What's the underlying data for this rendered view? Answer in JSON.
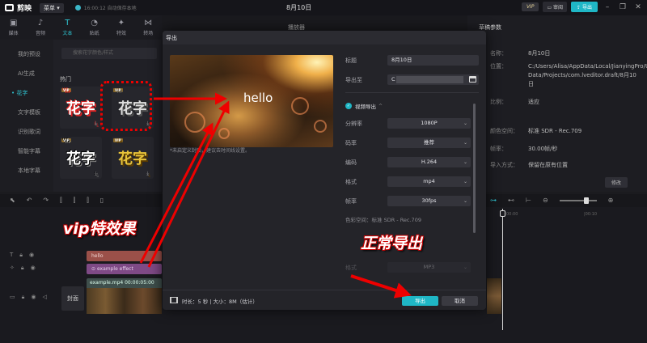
{
  "app": {
    "name": "剪映",
    "menu_label": "菜单",
    "autosave": "16:00:12 自动保存本地",
    "window_title": "8月10日",
    "vip": "VIP",
    "review": "审阅",
    "export": "导出"
  },
  "tools": [
    {
      "label": "媒体",
      "icon": "▣"
    },
    {
      "label": "音频",
      "icon": "♪"
    },
    {
      "label": "文本",
      "icon": "T"
    },
    {
      "label": "贴纸",
      "icon": "◔"
    },
    {
      "label": "特效",
      "icon": "✦"
    },
    {
      "label": "转场",
      "icon": "⋈"
    }
  ],
  "leftnav": [
    "我的预设",
    "AI生成",
    "• 花字",
    "文字模板",
    "识别歌词",
    "智能字幕",
    "本地字幕"
  ],
  "content": {
    "search_placeholder": "搜索花字颜色/样式",
    "hot_label": "热门",
    "tile_text": "花字",
    "vip_badge": "VIP"
  },
  "center_head": "播放器",
  "properties": {
    "title": "草稿参数",
    "rows": [
      {
        "k": "名称：",
        "v": "8月10日"
      },
      {
        "k": "位置：",
        "v": "C:/Users/Alisa/AppData/Local/JianyingPro/User Data/Projects/com.lveditor.draft/8月10日"
      },
      {
        "k": "比例：",
        "v": "适应"
      },
      {
        "k": "颜色空间：",
        "v": "标准 SDR - Rec.709"
      },
      {
        "k": "帧率：",
        "v": "30.00帧/秒"
      },
      {
        "k": "导入方式：",
        "v": "保留在原有位置"
      }
    ],
    "modify": "修改"
  },
  "timeline": {
    "ruler": [
      "00:00",
      "|00:10"
    ],
    "text_clip": "hello",
    "effect_clip": "example effect",
    "video_clip": "example.mp4   00:00:05:00",
    "cover": "封面"
  },
  "dialog": {
    "title": "导出",
    "preview_text": "hello",
    "note": "*未启定义封面，建议去时间线设置。",
    "title_label": "标题",
    "title_value": "8月10日",
    "export_to_label": "导出至",
    "export_to_value": "C",
    "section_label": "视频导出",
    "fields": [
      {
        "label": "分辨率",
        "value": "1080P"
      },
      {
        "label": "码率",
        "value": "推荐"
      },
      {
        "label": "编码",
        "value": "H.264"
      },
      {
        "label": "格式",
        "value": "mp4"
      },
      {
        "label": "帧率",
        "value": "30fps"
      }
    ],
    "color_space": "色彩空间：标准 SDR - Rec.709",
    "audio_format_label": "格式",
    "audio_format_value": "MP3",
    "footer_info": "时长：5 秒 | 大小：8M（估计）",
    "export_btn": "导出",
    "cancel_btn": "取消"
  },
  "annotations": {
    "vip_effect": "vip特效果",
    "normal_export": "正常导出"
  },
  "colors": {
    "accent": "#1fb7c6",
    "annotation_red": "#e00000"
  }
}
